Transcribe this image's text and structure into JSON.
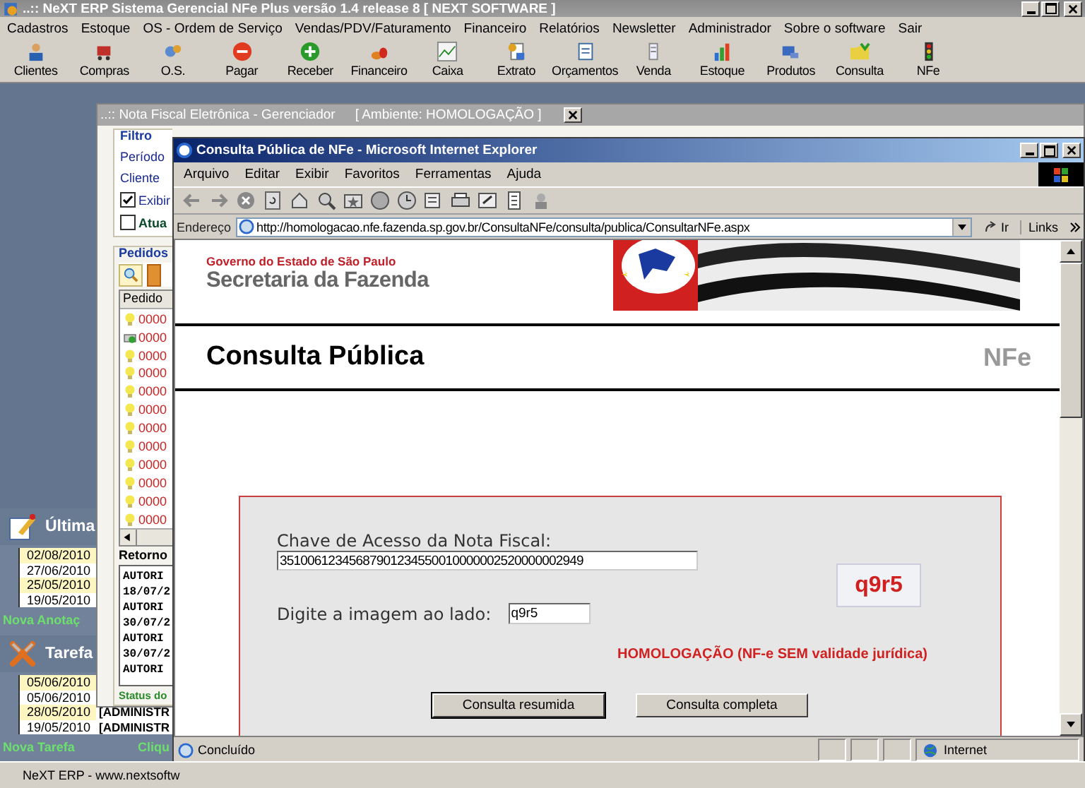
{
  "app": {
    "title": "..:: NeXT ERP Sistema Gerencial NFe Plus versão 1.4 release 8  [ NEXT SOFTWARE ]",
    "menu": [
      "Cadastros",
      "Estoque",
      "OS - Ordem de Serviço",
      "Vendas/PDV/Faturamento",
      "Financeiro",
      "Relatórios",
      "Newsletter",
      "Administrador",
      "Sobre o software",
      "Sair"
    ],
    "toolbar": [
      {
        "label": "Clientes",
        "kind": "people"
      },
      {
        "label": "Compras",
        "kind": "cart"
      },
      {
        "label": "O.S.",
        "kind": "gears"
      },
      {
        "label": "Pagar",
        "kind": "minus"
      },
      {
        "label": "Receber",
        "kind": "plus"
      },
      {
        "label": "Financeiro",
        "kind": "coins"
      },
      {
        "label": "Caixa",
        "kind": "linechart"
      },
      {
        "label": "Extrato",
        "kind": "document"
      },
      {
        "label": "Orçamentos",
        "kind": "notepad"
      },
      {
        "label": "Venda",
        "kind": "receipt"
      },
      {
        "label": "Estoque",
        "kind": "barchart"
      },
      {
        "label": "Produtos",
        "kind": "computer"
      },
      {
        "label": "Consulta",
        "kind": "folder"
      },
      {
        "label": "NFe",
        "kind": "traffic"
      }
    ],
    "status": "NeXT ERP - www.nextsoftw"
  },
  "side_panel": {
    "notes": {
      "title": "Última",
      "rows": [
        {
          "date": "02/08/2010",
          "highlighted": true
        },
        {
          "date": "27/06/2010",
          "highlighted": false
        },
        {
          "date": "25/05/2010",
          "highlighted": true
        },
        {
          "date": "19/05/2010",
          "highlighted": false
        }
      ],
      "action": "Nova Anotaç"
    },
    "tasks": {
      "title": "Tarefa",
      "rows": [
        {
          "date": "05/06/2010",
          "highlighted": true
        },
        {
          "date": "05/06/2010",
          "highlighted": false
        },
        {
          "date": "28/05/2010",
          "user": "[ADMINISTR",
          "highlighted": true
        },
        {
          "date": "19/05/2010",
          "user": "[ADMINISTR",
          "highlighted": false
        }
      ],
      "action": "Nova Tarefa",
      "link": "Cliqu"
    }
  },
  "nfe_window": {
    "title": "..:: Nota Fiscal Eletrônica - Gerenciador",
    "environment": "[ Ambiente: HOMOLOGAÇÃO ]",
    "filter": {
      "title": "Filtro",
      "period_label": "Período",
      "client_label": "Cliente",
      "checks": [
        {
          "label": "Exibir",
          "checked": true
        },
        {
          "label": "Atua",
          "checked": false
        }
      ]
    },
    "orders": {
      "title": "Pedidos",
      "column": "Pedido",
      "rows": [
        {
          "kind": "bulb",
          "number": "0000"
        },
        {
          "kind": "printer",
          "number": "0000"
        },
        {
          "kind": "bulb",
          "number": "0000"
        },
        {
          "kind": "bulb",
          "number": "0000"
        },
        {
          "kind": "bulb",
          "number": "0000"
        },
        {
          "kind": "bulb",
          "number": "0000"
        },
        {
          "kind": "bulb",
          "number": "0000"
        },
        {
          "kind": "bulb",
          "number": "0000"
        },
        {
          "kind": "bulb",
          "number": "0000"
        },
        {
          "kind": "bulb",
          "number": "0000"
        },
        {
          "kind": "bulb",
          "number": "0000"
        },
        {
          "kind": "bulb",
          "number": "0000"
        }
      ]
    },
    "return": {
      "title": "Retorno",
      "lines": [
        "AUTORI",
        "18/07/2",
        "AUTORI",
        "30/07/2",
        "AUTORI",
        "30/07/2",
        "AUTORI"
      ]
    },
    "status": "Status do"
  },
  "browser": {
    "title": "Consulta Pública de NFe - Microsoft Internet Explorer",
    "menu": [
      "Arquivo",
      "Editar",
      "Exibir",
      "Favoritos",
      "Ferramentas",
      "Ajuda"
    ],
    "address_label": "Endereço",
    "url": "http://homologacao.nfe.fazenda.sp.gov.br/ConsultaNFe/consulta/publica/ConsultarNFe.aspx",
    "go": "Ir",
    "links": "Links",
    "page": {
      "government": "Governo do Estado de São Paulo",
      "secretariat": "Secretaria da Fazenda",
      "heading": "Consulta Pública",
      "tag": "NFe",
      "key_label": "Chave de Acesso da Nota Fiscal:",
      "key_value": "35100612345687901234550010000002520000002949",
      "captcha": "q9r5",
      "captcha_label": "Digite a imagem ao lado:",
      "captcha_value": "q9r5",
      "warning": "HOMOLOGAÇÃO (NF-e SEM validade jurídica)",
      "buttons": [
        "Consulta resumida",
        "Consulta completa"
      ]
    },
    "status": "Concluído",
    "zone": "Internet"
  }
}
